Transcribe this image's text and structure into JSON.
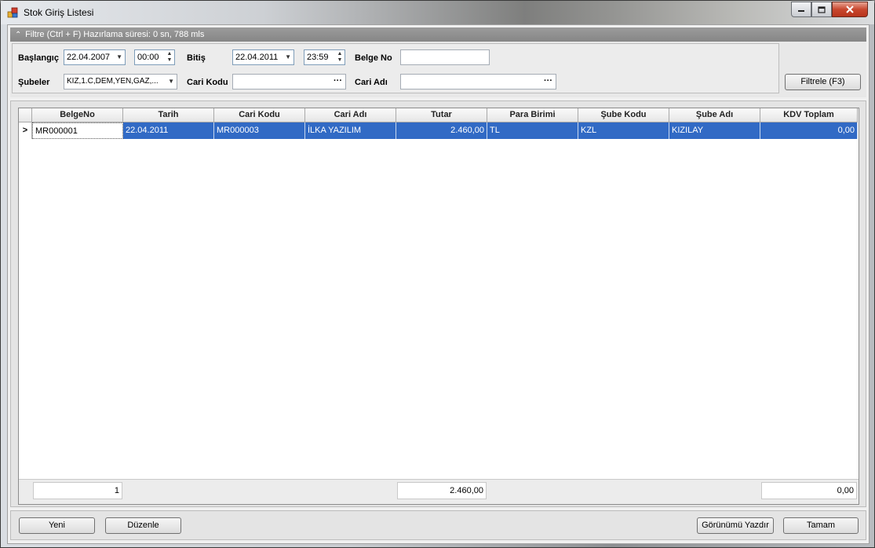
{
  "window": {
    "title": "Stok Giriş Listesi"
  },
  "filter": {
    "header": "Filtre (Ctrl + F) Hazırlama süresi: 0 sn, 788 mls",
    "baslangic_label": "Başlangıç",
    "baslangic_date": "22.04.2007",
    "baslangic_time": "00:00",
    "bitis_label": "Bitiş",
    "bitis_date": "22.04.2011",
    "bitis_time": "23:59",
    "belge_no_label": "Belge No",
    "belge_no_value": "",
    "subeler_label": "Şubeler",
    "subeler_value": "KIZ,1.C,DEM,YEN,GAZ,...",
    "cari_kodu_label": "Cari Kodu",
    "cari_kodu_value": "",
    "cari_adi_label": "Cari Adı",
    "cari_adi_value": "",
    "ellipsis": "···",
    "filter_button": "Filtrele (F3)"
  },
  "grid": {
    "columns": [
      "BelgeNo",
      "Tarih",
      "Cari Kodu",
      "Cari Adı",
      "Tutar",
      "Para Birimi",
      "Şube Kodu",
      "Şube Adı",
      "KDV Toplam"
    ],
    "row_indicator": ">",
    "rows": [
      {
        "belge_no": "MR000001",
        "tarih": "22.04.2011",
        "cari_kodu": "MR000003",
        "cari_adi": "İLKA YAZILIM",
        "tutar": "2.460,00",
        "para_birimi": "TL",
        "sube_kodu": "KZL",
        "sube_adi": "KIZILAY",
        "kdv_toplam": "0,00"
      }
    ],
    "footer": {
      "count": "1",
      "tutar_sum": "2.460,00",
      "kdv_sum": "0,00"
    }
  },
  "buttons": {
    "yeni": "Yeni",
    "duzenle": "Düzenle",
    "gorunumu_yazdir": "Görünümü Yazdır",
    "tamam": "Tamam"
  },
  "colors": {
    "selection": "#316ac5",
    "filter_header": "#8e8e8e",
    "close_button": "#c8472e"
  }
}
